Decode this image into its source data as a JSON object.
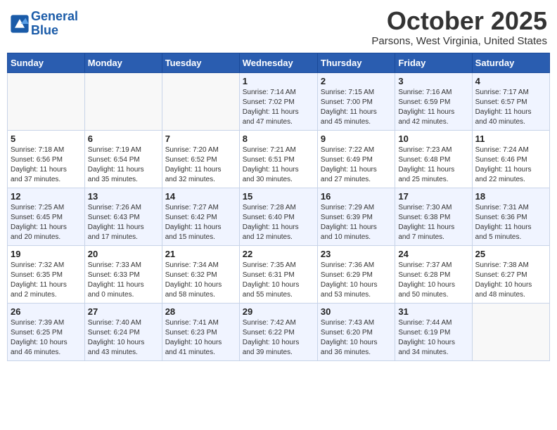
{
  "header": {
    "logo_line1": "General",
    "logo_line2": "Blue",
    "month": "October 2025",
    "location": "Parsons, West Virginia, United States"
  },
  "days_of_week": [
    "Sunday",
    "Monday",
    "Tuesday",
    "Wednesday",
    "Thursday",
    "Friday",
    "Saturday"
  ],
  "weeks": [
    [
      {
        "day": "",
        "info": ""
      },
      {
        "day": "",
        "info": ""
      },
      {
        "day": "",
        "info": ""
      },
      {
        "day": "1",
        "info": "Sunrise: 7:14 AM\nSunset: 7:02 PM\nDaylight: 11 hours\nand 47 minutes."
      },
      {
        "day": "2",
        "info": "Sunrise: 7:15 AM\nSunset: 7:00 PM\nDaylight: 11 hours\nand 45 minutes."
      },
      {
        "day": "3",
        "info": "Sunrise: 7:16 AM\nSunset: 6:59 PM\nDaylight: 11 hours\nand 42 minutes."
      },
      {
        "day": "4",
        "info": "Sunrise: 7:17 AM\nSunset: 6:57 PM\nDaylight: 11 hours\nand 40 minutes."
      }
    ],
    [
      {
        "day": "5",
        "info": "Sunrise: 7:18 AM\nSunset: 6:56 PM\nDaylight: 11 hours\nand 37 minutes."
      },
      {
        "day": "6",
        "info": "Sunrise: 7:19 AM\nSunset: 6:54 PM\nDaylight: 11 hours\nand 35 minutes."
      },
      {
        "day": "7",
        "info": "Sunrise: 7:20 AM\nSunset: 6:52 PM\nDaylight: 11 hours\nand 32 minutes."
      },
      {
        "day": "8",
        "info": "Sunrise: 7:21 AM\nSunset: 6:51 PM\nDaylight: 11 hours\nand 30 minutes."
      },
      {
        "day": "9",
        "info": "Sunrise: 7:22 AM\nSunset: 6:49 PM\nDaylight: 11 hours\nand 27 minutes."
      },
      {
        "day": "10",
        "info": "Sunrise: 7:23 AM\nSunset: 6:48 PM\nDaylight: 11 hours\nand 25 minutes."
      },
      {
        "day": "11",
        "info": "Sunrise: 7:24 AM\nSunset: 6:46 PM\nDaylight: 11 hours\nand 22 minutes."
      }
    ],
    [
      {
        "day": "12",
        "info": "Sunrise: 7:25 AM\nSunset: 6:45 PM\nDaylight: 11 hours\nand 20 minutes."
      },
      {
        "day": "13",
        "info": "Sunrise: 7:26 AM\nSunset: 6:43 PM\nDaylight: 11 hours\nand 17 minutes."
      },
      {
        "day": "14",
        "info": "Sunrise: 7:27 AM\nSunset: 6:42 PM\nDaylight: 11 hours\nand 15 minutes."
      },
      {
        "day": "15",
        "info": "Sunrise: 7:28 AM\nSunset: 6:40 PM\nDaylight: 11 hours\nand 12 minutes."
      },
      {
        "day": "16",
        "info": "Sunrise: 7:29 AM\nSunset: 6:39 PM\nDaylight: 11 hours\nand 10 minutes."
      },
      {
        "day": "17",
        "info": "Sunrise: 7:30 AM\nSunset: 6:38 PM\nDaylight: 11 hours\nand 7 minutes."
      },
      {
        "day": "18",
        "info": "Sunrise: 7:31 AM\nSunset: 6:36 PM\nDaylight: 11 hours\nand 5 minutes."
      }
    ],
    [
      {
        "day": "19",
        "info": "Sunrise: 7:32 AM\nSunset: 6:35 PM\nDaylight: 11 hours\nand 2 minutes."
      },
      {
        "day": "20",
        "info": "Sunrise: 7:33 AM\nSunset: 6:33 PM\nDaylight: 11 hours\nand 0 minutes."
      },
      {
        "day": "21",
        "info": "Sunrise: 7:34 AM\nSunset: 6:32 PM\nDaylight: 10 hours\nand 58 minutes."
      },
      {
        "day": "22",
        "info": "Sunrise: 7:35 AM\nSunset: 6:31 PM\nDaylight: 10 hours\nand 55 minutes."
      },
      {
        "day": "23",
        "info": "Sunrise: 7:36 AM\nSunset: 6:29 PM\nDaylight: 10 hours\nand 53 minutes."
      },
      {
        "day": "24",
        "info": "Sunrise: 7:37 AM\nSunset: 6:28 PM\nDaylight: 10 hours\nand 50 minutes."
      },
      {
        "day": "25",
        "info": "Sunrise: 7:38 AM\nSunset: 6:27 PM\nDaylight: 10 hours\nand 48 minutes."
      }
    ],
    [
      {
        "day": "26",
        "info": "Sunrise: 7:39 AM\nSunset: 6:25 PM\nDaylight: 10 hours\nand 46 minutes."
      },
      {
        "day": "27",
        "info": "Sunrise: 7:40 AM\nSunset: 6:24 PM\nDaylight: 10 hours\nand 43 minutes."
      },
      {
        "day": "28",
        "info": "Sunrise: 7:41 AM\nSunset: 6:23 PM\nDaylight: 10 hours\nand 41 minutes."
      },
      {
        "day": "29",
        "info": "Sunrise: 7:42 AM\nSunset: 6:22 PM\nDaylight: 10 hours\nand 39 minutes."
      },
      {
        "day": "30",
        "info": "Sunrise: 7:43 AM\nSunset: 6:20 PM\nDaylight: 10 hours\nand 36 minutes."
      },
      {
        "day": "31",
        "info": "Sunrise: 7:44 AM\nSunset: 6:19 PM\nDaylight: 10 hours\nand 34 minutes."
      },
      {
        "day": "",
        "info": ""
      }
    ]
  ]
}
